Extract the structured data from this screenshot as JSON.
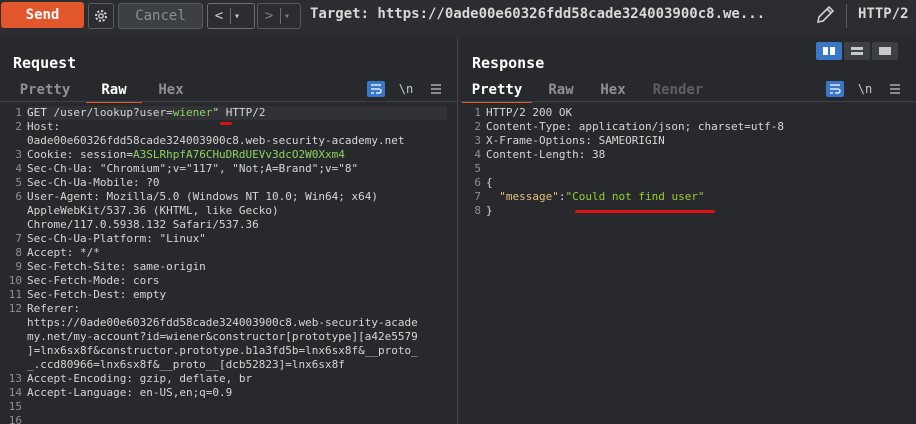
{
  "toolbar": {
    "send_label": "Send",
    "cancel_label": "Cancel",
    "back_arrow": "<",
    "forward_arrow": ">",
    "dropdown_glyph": "▾",
    "target_text": "Target: https://0ade00e60326fdd58cade324003900c8.we...",
    "http_version": "HTTP/2",
    "accent_color": "#e2562b"
  },
  "request": {
    "title": "Request",
    "tabs": [
      "Pretty",
      "Raw",
      "Hex"
    ],
    "active_tab": "Raw",
    "newline_toggle": "\\n",
    "lines": [
      {
        "n": "1",
        "method": "GET",
        "path_prefix": " /user/lookup?",
        "param": "user=",
        "value": "wiener",
        "rest": "\" HTTP/2"
      },
      {
        "n": "2",
        "text": "Host:"
      },
      {
        "n": "",
        "text": "0ade00e60326fdd58cade324003900c8.web-security-academy.net"
      },
      {
        "n": "3",
        "key": "Cookie:",
        "cookie_name": " session=",
        "cookie_value": "A3SLRhpfA76CHuDRdUEVv3dcO2W0Xxm4"
      },
      {
        "n": "4",
        "text": "Sec-Ch-Ua: \"Chromium\";v=\"117\", \"Not;A=Brand\";v=\"8\""
      },
      {
        "n": "5",
        "text": "Sec-Ch-Ua-Mobile: ?0"
      },
      {
        "n": "6",
        "text": "User-Agent: Mozilla/5.0 (Windows NT 10.0; Win64; x64)"
      },
      {
        "n": "",
        "text": "AppleWebKit/537.36 (KHTML, like Gecko)"
      },
      {
        "n": "",
        "text": "Chrome/117.0.5938.132 Safari/537.36"
      },
      {
        "n": "7",
        "text": "Sec-Ch-Ua-Platform: \"Linux\""
      },
      {
        "n": "8",
        "text": "Accept: */*"
      },
      {
        "n": "9",
        "text": "Sec-Fetch-Site: same-origin"
      },
      {
        "n": "10",
        "text": "Sec-Fetch-Mode: cors"
      },
      {
        "n": "11",
        "text": "Sec-Fetch-Dest: empty"
      },
      {
        "n": "12",
        "text": "Referer:"
      },
      {
        "n": "",
        "text": "https://0ade00e60326fdd58cade324003900c8.web-security-acade"
      },
      {
        "n": "",
        "text": "my.net/my-account?id=wiener&constructor[prototype][a42e5579"
      },
      {
        "n": "",
        "text": "]=lnx6sx8f&constructor.prototype.b1a3fd5b=lnx6sx8f&__proto_"
      },
      {
        "n": "",
        "text": "_.ccd80966=lnx6sx8f&__proto__[dcb52823]=lnx6sx8f"
      },
      {
        "n": "13",
        "text": "Accept-Encoding: gzip, deflate, br"
      },
      {
        "n": "14",
        "text": "Accept-Language: en-US,en;q=0.9"
      },
      {
        "n": "15",
        "text": ""
      },
      {
        "n": "16",
        "text": ""
      }
    ]
  },
  "response": {
    "title": "Response",
    "tabs": [
      "Pretty",
      "Raw",
      "Hex",
      "Render"
    ],
    "active_tab": "Pretty",
    "newline_toggle": "\\n",
    "lines": [
      {
        "n": "1",
        "text": "HTTP/2 200 OK"
      },
      {
        "n": "2",
        "text": "Content-Type: application/json; charset=utf-8"
      },
      {
        "n": "3",
        "text": "X-Frame-Options: SAMEORIGIN"
      },
      {
        "n": "4",
        "text": "Content-Length: 38"
      },
      {
        "n": "5",
        "text": ""
      },
      {
        "n": "6",
        "text": "{"
      },
      {
        "n": "7",
        "key": "\"message\"",
        "colon": ":",
        "value": "\"Could not find user\""
      },
      {
        "n": "8",
        "text": "}"
      }
    ]
  }
}
